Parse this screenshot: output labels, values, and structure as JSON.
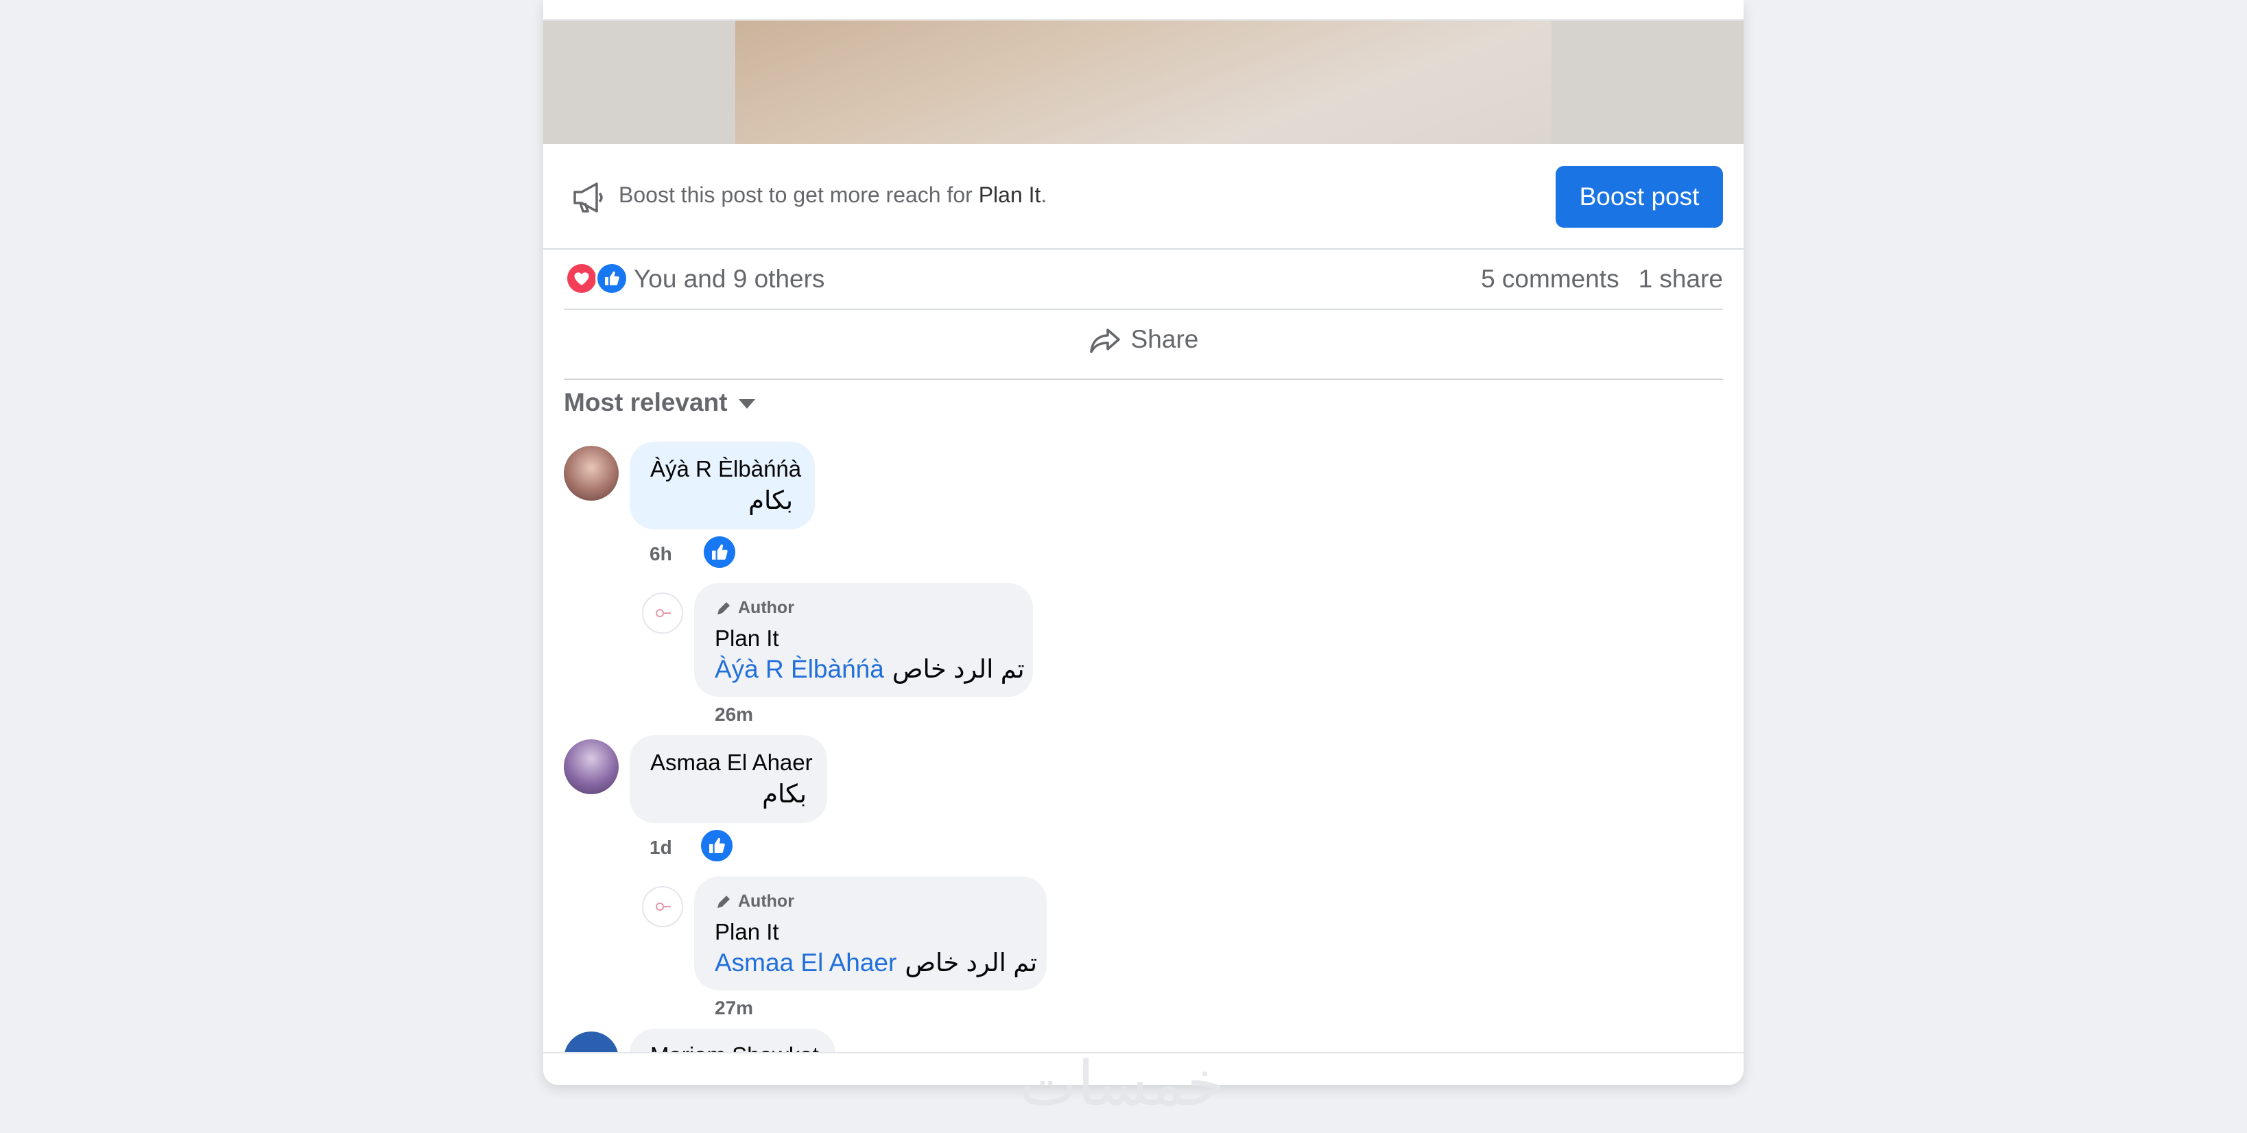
{
  "boost": {
    "prefix": "Boost this post to get more reach for ",
    "page_name": "Plan It",
    "suffix": ".",
    "button": "Boost post"
  },
  "reactions": {
    "summary": "You and 9 others",
    "comments": "5 comments",
    "shares": "1 share",
    "icons": [
      "love-icon",
      "like-icon"
    ]
  },
  "actions": {
    "share_label": "Share"
  },
  "sort": {
    "label": "Most relevant"
  },
  "comments": [
    {
      "name": "Àýà R Èlbàńńà",
      "text": "بكام",
      "time": "6h",
      "reply": {
        "badge": "Author",
        "name": "Plan It",
        "mention": "Àýà R Èlbàńńà",
        "text": "تم الرد خاص",
        "time": "26m"
      }
    },
    {
      "name": "Asmaa El Ahaer",
      "text": "بكام",
      "time": "1d",
      "reply": {
        "badge": "Author",
        "name": "Plan It",
        "mention": "Asmaa El Ahaer",
        "text": "تم الرد خاص",
        "time": "27m"
      }
    },
    {
      "name": "Mariam Shawkat"
    }
  ],
  "watermark": "خمسات",
  "colors": {
    "accent": "#1b74e4",
    "mention": "#216fdb",
    "muted": "#65676b"
  }
}
